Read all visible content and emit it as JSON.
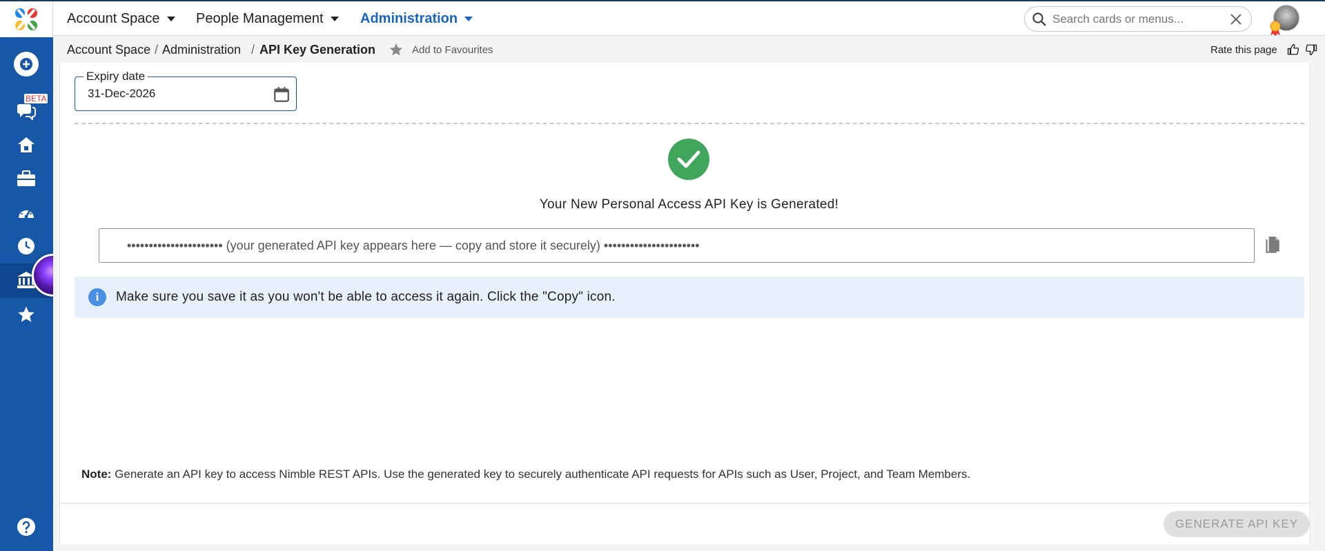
{
  "header": {
    "nav": [
      {
        "label": "Account Space"
      },
      {
        "label": "People Management"
      },
      {
        "label": "Administration"
      }
    ],
    "search_placeholder": "Search cards or menus..."
  },
  "sidebar": {
    "beta_badge": "BETA"
  },
  "breadcrumb": {
    "items": [
      "Account Space",
      "Administration",
      "API Key Generation"
    ],
    "separator": "/",
    "add_favourites": "Add to Favourites",
    "rate_page": "Rate this page"
  },
  "form": {
    "expiry_label": "Expiry date",
    "expiry_value": "31-Dec-2026"
  },
  "result": {
    "success_message": "Your New Personal Access API Key is Generated!",
    "api_key_display": "••••••••••••••••••••••  (your generated API key appears here — copy and store it securely)  ••••••••••••••••••••••",
    "info_message": "Make sure you save it as you won't be able to access it again. Click the \"Copy\" icon."
  },
  "note": {
    "label": "Note:",
    "text": " Generate an API key to access Nimble REST APIs. Use the generated key to securely authenticate API requests for APIs such as User, Project, and Team Members."
  },
  "actions": {
    "generate_label": "GENERATE API KEY"
  },
  "colors": {
    "sidebar": "#1757a8",
    "active_nav": "#1565c0",
    "success": "#3fa65b",
    "info_bg": "#e8f1fb"
  }
}
